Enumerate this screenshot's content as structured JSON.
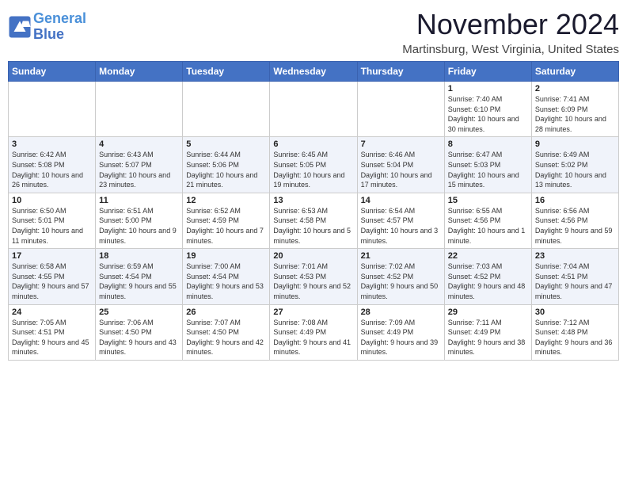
{
  "header": {
    "logo_line1": "General",
    "logo_line2": "Blue",
    "month_title": "November 2024",
    "location": "Martinsburg, West Virginia, United States"
  },
  "days_of_week": [
    "Sunday",
    "Monday",
    "Tuesday",
    "Wednesday",
    "Thursday",
    "Friday",
    "Saturday"
  ],
  "weeks": [
    [
      {
        "day": "",
        "info": ""
      },
      {
        "day": "",
        "info": ""
      },
      {
        "day": "",
        "info": ""
      },
      {
        "day": "",
        "info": ""
      },
      {
        "day": "",
        "info": ""
      },
      {
        "day": "1",
        "info": "Sunrise: 7:40 AM\nSunset: 6:10 PM\nDaylight: 10 hours and 30 minutes."
      },
      {
        "day": "2",
        "info": "Sunrise: 7:41 AM\nSunset: 6:09 PM\nDaylight: 10 hours and 28 minutes."
      }
    ],
    [
      {
        "day": "3",
        "info": "Sunrise: 6:42 AM\nSunset: 5:08 PM\nDaylight: 10 hours and 26 minutes."
      },
      {
        "day": "4",
        "info": "Sunrise: 6:43 AM\nSunset: 5:07 PM\nDaylight: 10 hours and 23 minutes."
      },
      {
        "day": "5",
        "info": "Sunrise: 6:44 AM\nSunset: 5:06 PM\nDaylight: 10 hours and 21 minutes."
      },
      {
        "day": "6",
        "info": "Sunrise: 6:45 AM\nSunset: 5:05 PM\nDaylight: 10 hours and 19 minutes."
      },
      {
        "day": "7",
        "info": "Sunrise: 6:46 AM\nSunset: 5:04 PM\nDaylight: 10 hours and 17 minutes."
      },
      {
        "day": "8",
        "info": "Sunrise: 6:47 AM\nSunset: 5:03 PM\nDaylight: 10 hours and 15 minutes."
      },
      {
        "day": "9",
        "info": "Sunrise: 6:49 AM\nSunset: 5:02 PM\nDaylight: 10 hours and 13 minutes."
      }
    ],
    [
      {
        "day": "10",
        "info": "Sunrise: 6:50 AM\nSunset: 5:01 PM\nDaylight: 10 hours and 11 minutes."
      },
      {
        "day": "11",
        "info": "Sunrise: 6:51 AM\nSunset: 5:00 PM\nDaylight: 10 hours and 9 minutes."
      },
      {
        "day": "12",
        "info": "Sunrise: 6:52 AM\nSunset: 4:59 PM\nDaylight: 10 hours and 7 minutes."
      },
      {
        "day": "13",
        "info": "Sunrise: 6:53 AM\nSunset: 4:58 PM\nDaylight: 10 hours and 5 minutes."
      },
      {
        "day": "14",
        "info": "Sunrise: 6:54 AM\nSunset: 4:57 PM\nDaylight: 10 hours and 3 minutes."
      },
      {
        "day": "15",
        "info": "Sunrise: 6:55 AM\nSunset: 4:56 PM\nDaylight: 10 hours and 1 minute."
      },
      {
        "day": "16",
        "info": "Sunrise: 6:56 AM\nSunset: 4:56 PM\nDaylight: 9 hours and 59 minutes."
      }
    ],
    [
      {
        "day": "17",
        "info": "Sunrise: 6:58 AM\nSunset: 4:55 PM\nDaylight: 9 hours and 57 minutes."
      },
      {
        "day": "18",
        "info": "Sunrise: 6:59 AM\nSunset: 4:54 PM\nDaylight: 9 hours and 55 minutes."
      },
      {
        "day": "19",
        "info": "Sunrise: 7:00 AM\nSunset: 4:54 PM\nDaylight: 9 hours and 53 minutes."
      },
      {
        "day": "20",
        "info": "Sunrise: 7:01 AM\nSunset: 4:53 PM\nDaylight: 9 hours and 52 minutes."
      },
      {
        "day": "21",
        "info": "Sunrise: 7:02 AM\nSunset: 4:52 PM\nDaylight: 9 hours and 50 minutes."
      },
      {
        "day": "22",
        "info": "Sunrise: 7:03 AM\nSunset: 4:52 PM\nDaylight: 9 hours and 48 minutes."
      },
      {
        "day": "23",
        "info": "Sunrise: 7:04 AM\nSunset: 4:51 PM\nDaylight: 9 hours and 47 minutes."
      }
    ],
    [
      {
        "day": "24",
        "info": "Sunrise: 7:05 AM\nSunset: 4:51 PM\nDaylight: 9 hours and 45 minutes."
      },
      {
        "day": "25",
        "info": "Sunrise: 7:06 AM\nSunset: 4:50 PM\nDaylight: 9 hours and 43 minutes."
      },
      {
        "day": "26",
        "info": "Sunrise: 7:07 AM\nSunset: 4:50 PM\nDaylight: 9 hours and 42 minutes."
      },
      {
        "day": "27",
        "info": "Sunrise: 7:08 AM\nSunset: 4:49 PM\nDaylight: 9 hours and 41 minutes."
      },
      {
        "day": "28",
        "info": "Sunrise: 7:09 AM\nSunset: 4:49 PM\nDaylight: 9 hours and 39 minutes."
      },
      {
        "day": "29",
        "info": "Sunrise: 7:11 AM\nSunset: 4:49 PM\nDaylight: 9 hours and 38 minutes."
      },
      {
        "day": "30",
        "info": "Sunrise: 7:12 AM\nSunset: 4:48 PM\nDaylight: 9 hours and 36 minutes."
      }
    ]
  ]
}
